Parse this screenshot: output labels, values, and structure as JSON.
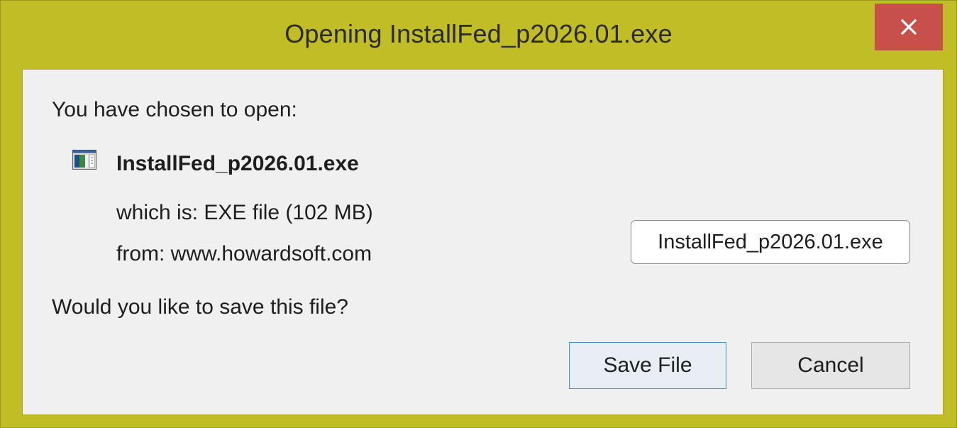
{
  "window": {
    "title": "Opening InstallFed_p2026.01.exe",
    "close_icon": "close-icon",
    "accent_color": "#c1bd27",
    "close_color": "#c7504a"
  },
  "dialog": {
    "intro": "You have chosen to open:",
    "file_icon": "executable-file-icon",
    "file_name": "InstallFed_p2026.01.exe",
    "which_is": "which is:  EXE file (102 MB)",
    "from": "from:  www.howardsoft.com",
    "question": "Would you like to save this file?",
    "name_field_value": "InstallFed_p2026.01.exe"
  },
  "buttons": {
    "save_label": "Save File",
    "cancel_label": "Cancel"
  }
}
